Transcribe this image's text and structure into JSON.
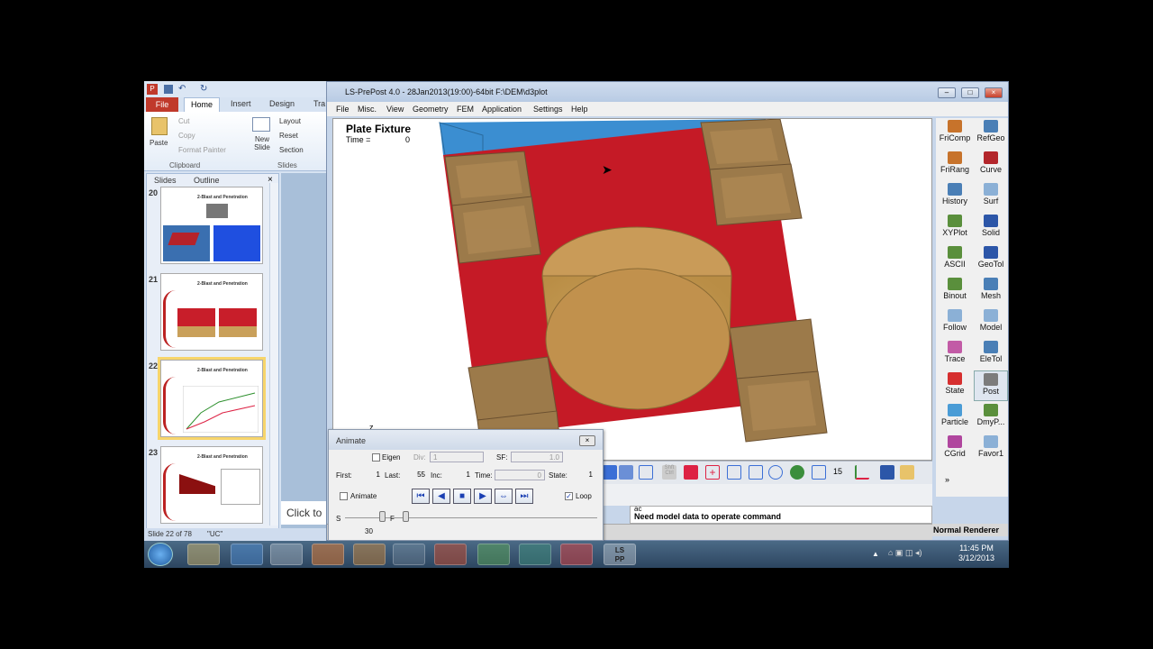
{
  "ppt": {
    "tabs": [
      "File",
      "Home",
      "Insert",
      "Design",
      "Tra"
    ],
    "clipboard": {
      "paste": "Paste",
      "cut": "Cut",
      "copy": "Copy",
      "format_painter": "Format Painter",
      "group": "Clipboard"
    },
    "slides": {
      "new_slide": "New Slide",
      "layout": "Layout",
      "reset": "Reset",
      "section": "Section",
      "group": "Slides"
    },
    "panel_tabs": [
      "Slides",
      "Outline"
    ],
    "thumbs": [
      {
        "num": "20",
        "title": "2-Blast and Penetration"
      },
      {
        "num": "21",
        "title": "2-Blast and Penetration"
      },
      {
        "num": "22",
        "title": "2-Blast and Penetration"
      },
      {
        "num": "23",
        "title": "2-Blast and Penetration"
      }
    ],
    "click_to": "Click to",
    "status": "Slide 22 of 78",
    "status_lang": "\"UC\""
  },
  "lsp": {
    "title": "LS-PrePost 4.0 - 28Jan2013(19:00)-64bit F:\\DEM\\d3plot",
    "menu": [
      "File",
      "Misc.",
      "View",
      "Geometry",
      "FEM",
      "Application",
      "Settings",
      "Help"
    ],
    "plot_title": "Plate Fixture",
    "time_label": "Time =",
    "time_value": "0",
    "axis_label": "z",
    "tools": [
      {
        "name": "fricomp",
        "label": "FriComp",
        "color": "#c7732b"
      },
      {
        "name": "refgeo",
        "label": "RefGeo",
        "color": "#4a7fb6"
      },
      {
        "name": "frirang",
        "label": "FriRang",
        "color": "#c7732b"
      },
      {
        "name": "curve",
        "label": "Curve",
        "color": "#b3262b"
      },
      {
        "name": "history",
        "label": "History",
        "color": "#4a7fb6"
      },
      {
        "name": "surf",
        "label": "Surf",
        "color": "#8bb0d6"
      },
      {
        "name": "xyplot",
        "label": "XYPlot",
        "color": "#5a8f3c"
      },
      {
        "name": "solid",
        "label": "Solid",
        "color": "#2c56a8"
      },
      {
        "name": "ascii",
        "label": "ASCII",
        "color": "#5a8f3c"
      },
      {
        "name": "geotol",
        "label": "GeoTol",
        "color": "#2c56a8"
      },
      {
        "name": "binout",
        "label": "Binout",
        "color": "#5a8f3c"
      },
      {
        "name": "mesh",
        "label": "Mesh",
        "color": "#4a7fb6"
      },
      {
        "name": "follow",
        "label": "Follow",
        "color": "#8bb0d6"
      },
      {
        "name": "model",
        "label": "Model",
        "color": "#8bb0d6"
      },
      {
        "name": "trace",
        "label": "Trace",
        "color": "#c25ba6"
      },
      {
        "name": "eletol",
        "label": "EleTol",
        "color": "#4a7fb6"
      },
      {
        "name": "state",
        "label": "State",
        "color": "#d62f2f"
      },
      {
        "name": "post",
        "label": "Post",
        "color": "#7c7c7c"
      },
      {
        "name": "particle",
        "label": "Particle",
        "color": "#4a9cd6"
      },
      {
        "name": "dmyp",
        "label": "DmyP...",
        "color": "#5a8f3c"
      },
      {
        "name": "cgrid",
        "label": "CGrid",
        "color": "#b0469e"
      },
      {
        "name": "favor1",
        "label": "Favor1",
        "color": "#8bb0d6"
      }
    ],
    "iconbar_num": "15",
    "msg_line1": "ac",
    "msg_line2": "Need model data to operate command",
    "renderer": "Normal Renderer"
  },
  "anim": {
    "title": "Animate",
    "eigen": "Eigen",
    "div_label": "Div:",
    "div_value": "1",
    "sf_label": "SF:",
    "sf_value": "1.0",
    "first_label": "First:",
    "first_value": "1",
    "last_label": "Last:",
    "last_value": "55",
    "inc_label": "Inc:",
    "inc_value": "1",
    "time_label": "Time:",
    "time_value": "0",
    "state_label": "State:",
    "state_value": "1",
    "animate_label": "Animate",
    "loop_label": "Loop",
    "s_label": "S",
    "f_label": "F",
    "speed_value": "30"
  },
  "taskbar": {
    "time": "11:45 PM",
    "date": "3/12/2013"
  }
}
